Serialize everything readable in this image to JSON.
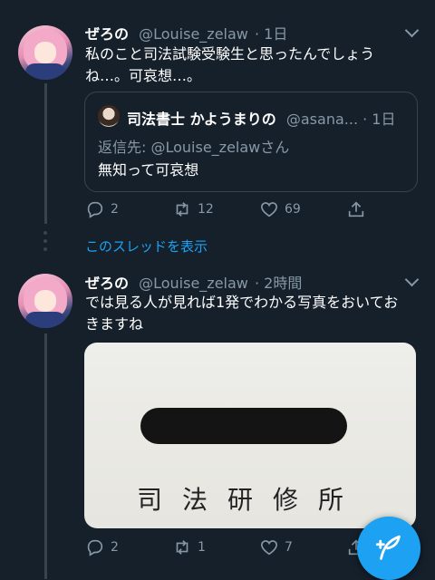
{
  "tweet1": {
    "name": "ぜろの",
    "handle": "@Louise_zelaw",
    "time": "· 1日",
    "text_line1": "私のこと司法試験受験生と思ったんでしょう",
    "text_line2": "ね…。可哀想…。",
    "quote": {
      "name": "司法書士 かようまりの",
      "handle": "@asana...",
      "time": "· 1日",
      "reply_to": "返信先: @Louise_zelawさん",
      "text": "無知って可哀想"
    },
    "actions": {
      "replies": "2",
      "retweets": "12",
      "likes": "69"
    }
  },
  "show_thread": "このスレッドを表示",
  "tweet2": {
    "name": "ぜろの",
    "handle": "@Louise_zelaw",
    "time": "· 2時間",
    "text_line1": "では見る人が見れば1発でわかる写真をおいてお",
    "text_line2": "きますね",
    "photo_text": "司法研修所",
    "actions": {
      "replies": "2",
      "retweets": "1",
      "likes": "7"
    }
  },
  "icons": {
    "reply": "reply-icon",
    "retweet": "retweet-icon",
    "like": "heart-icon",
    "share": "share-icon",
    "compose": "compose-tweet-icon",
    "more": "chevron-down-icon"
  },
  "colors": {
    "background": "#15202b",
    "accent": "#1da1f2",
    "muted": "#8899a6"
  }
}
